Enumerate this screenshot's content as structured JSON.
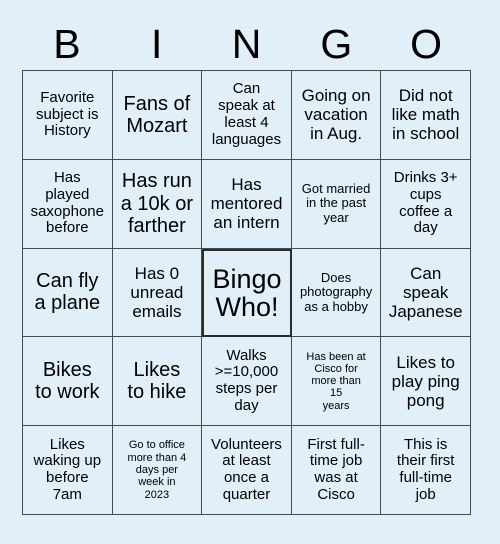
{
  "header": {
    "letters": [
      "B",
      "I",
      "N",
      "G",
      "O"
    ]
  },
  "grid": {
    "rows": 5,
    "columns": 5,
    "background_color": "#e1f0f8",
    "border_color": "#4a4a4a",
    "free_space_border_color": "#2b2b2b",
    "text_color": "#000000",
    "cells": [
      {
        "text": "Favorite\nsubject is\nHistory",
        "size": "m",
        "free": false
      },
      {
        "text": "Fans of\nMozart",
        "size": "xl",
        "free": false
      },
      {
        "text": "Can\nspeak at\nleast 4\nlanguages",
        "size": "m",
        "free": false
      },
      {
        "text": "Going on\nvacation\nin Aug.",
        "size": "l",
        "free": false
      },
      {
        "text": "Did not\nlike math\nin school",
        "size": "l",
        "free": false
      },
      {
        "text": "Has\nplayed\nsaxophone\nbefore",
        "size": "m",
        "free": false
      },
      {
        "text": "Has run\na 10k or\nfarther",
        "size": "xl",
        "free": false
      },
      {
        "text": "Has\nmentored\nan intern",
        "size": "l",
        "free": false
      },
      {
        "text": "Got married\nin the past\nyear",
        "size": "s",
        "free": false
      },
      {
        "text": "Drinks 3+\ncups\ncoffee a\nday",
        "size": "m",
        "free": false
      },
      {
        "text": "Can fly\na plane",
        "size": "xl",
        "free": false
      },
      {
        "text": "Has 0\nunread\nemails",
        "size": "l",
        "free": false
      },
      {
        "text": "Bingo\nWho!",
        "size": "free",
        "free": true
      },
      {
        "text": "Does\nphotography\nas a hobby",
        "size": "s",
        "free": false
      },
      {
        "text": "Can\nspeak\nJapanese",
        "size": "l",
        "free": false
      },
      {
        "text": "Bikes\nto work",
        "size": "xl",
        "free": false
      },
      {
        "text": "Likes\nto hike",
        "size": "xl",
        "free": false
      },
      {
        "text": "Walks\n>=10,000\nsteps per\nday",
        "size": "m",
        "free": false
      },
      {
        "text": "Has been at\nCisco for\nmore than\n15\nyears",
        "size": "xs",
        "free": false
      },
      {
        "text": "Likes to\nplay ping\npong",
        "size": "l",
        "free": false
      },
      {
        "text": "Likes\nwaking up\nbefore\n7am",
        "size": "m",
        "free": false
      },
      {
        "text": "Go to office\nmore than 4\ndays per\nweek in\n2023",
        "size": "xs",
        "free": false
      },
      {
        "text": "Volunteers\nat least\nonce a\nquarter",
        "size": "m",
        "free": false
      },
      {
        "text": "First full-\ntime job\nwas at\nCisco",
        "size": "m",
        "free": false
      },
      {
        "text": "This is\ntheir first\nfull-time\njob",
        "size": "m",
        "free": false
      }
    ]
  }
}
